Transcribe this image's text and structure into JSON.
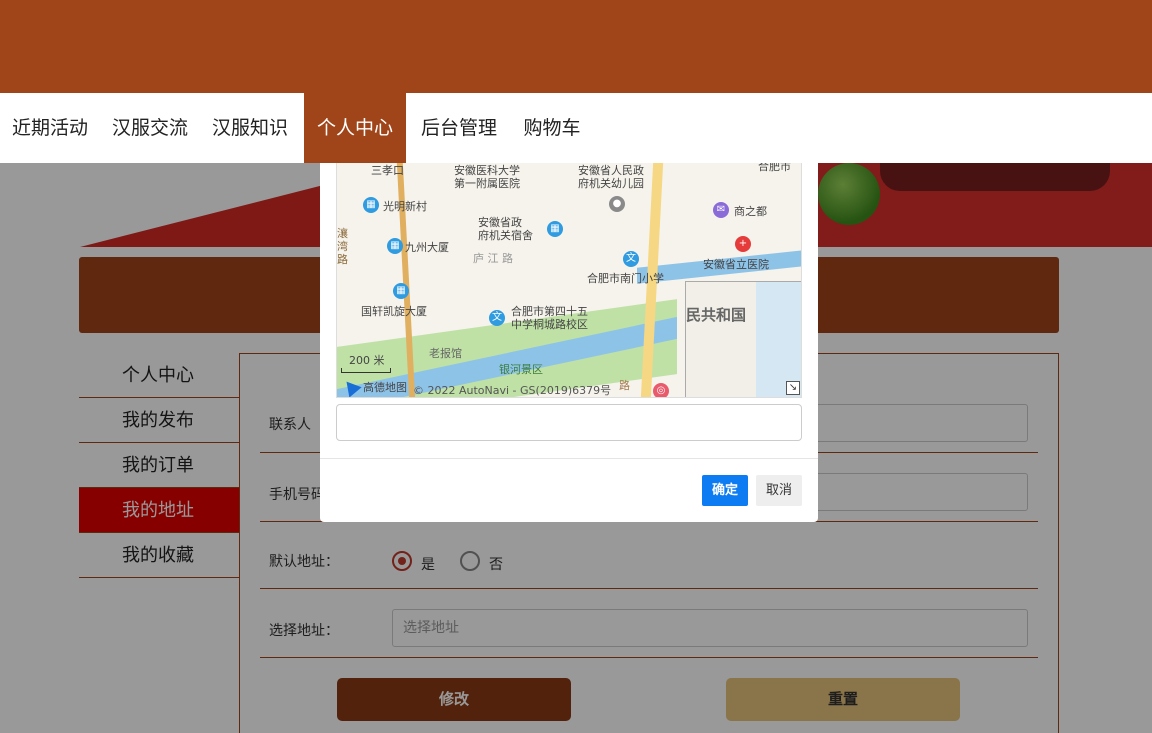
{
  "nav": {
    "items": [
      {
        "label": "近期活动"
      },
      {
        "label": "汉服交流"
      },
      {
        "label": "汉服知识"
      },
      {
        "label": "个人中心"
      },
      {
        "label": "后台管理"
      },
      {
        "label": "购物车"
      }
    ],
    "active_index": 3
  },
  "sidebar": {
    "items": [
      {
        "label": "个人中心"
      },
      {
        "label": "我的发布"
      },
      {
        "label": "我的订单"
      },
      {
        "label": "我的地址"
      },
      {
        "label": "我的收藏"
      }
    ],
    "active_index": 3
  },
  "form": {
    "contact_label": "联系人",
    "phone_label": "手机号码",
    "default_label": "默认地址：",
    "default_yes": "是",
    "default_no": "否",
    "default_value": "是",
    "select_label": "选择地址：",
    "select_placeholder": "选择地址",
    "submit_label": "修改",
    "reset_label": "重置"
  },
  "modal": {
    "map": {
      "labels": {
        "sanxiaokou": "三孝口",
        "anyi": "安徽医科大学\n第一附属医院",
        "youeryuan": "安徽省人民政\n府机关幼儿园",
        "hefeishi": "合肥市",
        "guangming": "光明新村",
        "shangzhidu": "商之都",
        "sushe": "安徽省政\n府机关宿舍",
        "jiuzhou": "九州大厦",
        "lujiang": "庐 江 路",
        "nanmen": "合肥市南门小学",
        "liyuan": "安徽省立医院",
        "huailu": "瀼\n湾\n路",
        "guoxuan": "国轩凯旋大厦",
        "sishiwu": "合肥市第四十五\n中学桐城路校区",
        "laobaoguan": "老报馆",
        "scale": "200 米",
        "yinhe": "银河景区",
        "gaode": "高德地图",
        "copyright": "© 2022 AutoNavi - GS(2019)6379号",
        "road": "路",
        "overview": "民共和国"
      }
    },
    "search_value": "",
    "ok_label": "确定",
    "cancel_label": "取消"
  },
  "colors": {
    "brand": "#a0451a",
    "active_menu": "#e00000",
    "primary_button": "#0d7cf2",
    "reset_button": "#e6c27a"
  }
}
